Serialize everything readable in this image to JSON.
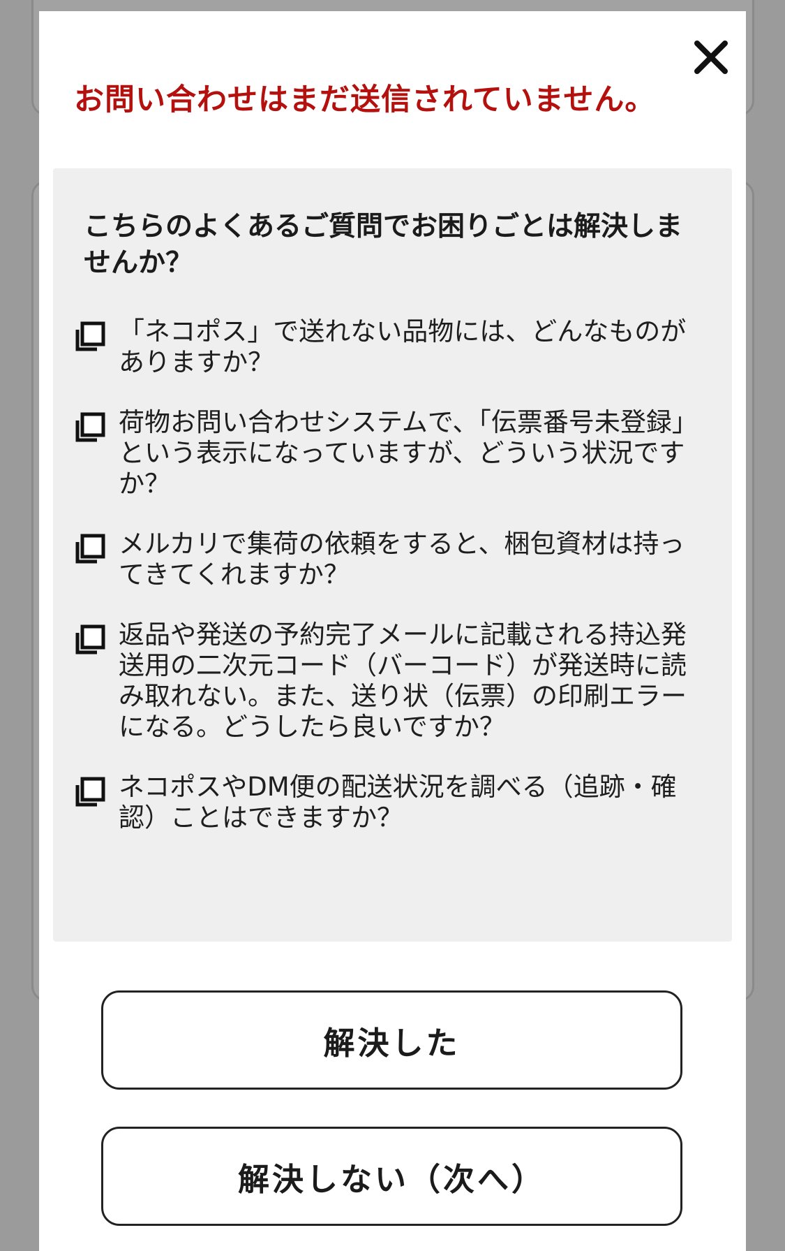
{
  "modal": {
    "title": "お問い合わせはまだ送信されていません。",
    "close_icon": "close-icon"
  },
  "faq": {
    "question": "こちらのよくあるご質問でお困りごとは解決しませんか？",
    "item_icon": "copy-icon",
    "items": [
      {
        "label": "「ネコポス」で送れない品物には、どんなものがありますか？"
      },
      {
        "label": "荷物お問い合わせシステムで、「伝票番号未登録」という表示になっていますが、どういう状況ですか？"
      },
      {
        "label": "メルカリで集荷の依頼をすると、梱包資材は持ってきてくれますか？"
      },
      {
        "label": "返品や発送の予約完了メールに記載される持込発送用の二次元コード（バーコード）が発送時に読み取れない。また、送り状（伝票）の印刷エラーになる。どうしたら良いですか？"
      },
      {
        "label": "ネコポスやDM便の配送状況を調べる（追跡・確認）ことはできますか？"
      }
    ]
  },
  "buttons": {
    "resolved_label": "解決した",
    "not_resolved_label": "解決しない（次へ）"
  },
  "colors": {
    "title_red": "#b3100e",
    "panel_bg": "#efefef",
    "overlay": "#9b9b9b"
  }
}
